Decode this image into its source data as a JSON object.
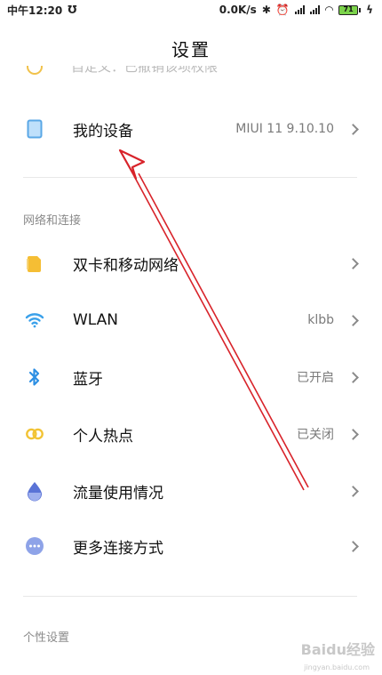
{
  "status_bar": {
    "time": "中午12:20",
    "speed": "0.0K/s",
    "battery": "71"
  },
  "header": {
    "title": "设置"
  },
  "cut_row": {
    "label": "自定义：已撤销该项权限"
  },
  "rows_top": [
    {
      "label": "我的设备",
      "value": "MIUI 11 9.10.10",
      "icon": "device-icon"
    }
  ],
  "network": {
    "title": "网络和连接",
    "items": [
      {
        "label": "双卡和移动网络",
        "value": "",
        "icon": "sim-card-icon"
      },
      {
        "label": "WLAN",
        "value": "klbb",
        "icon": "wifi-icon"
      },
      {
        "label": "蓝牙",
        "value": "已开启",
        "icon": "bluetooth-icon"
      },
      {
        "label": "个人热点",
        "value": "已关闭",
        "icon": "hotspot-icon"
      },
      {
        "label": "流量使用情况",
        "value": "",
        "icon": "data-usage-icon"
      },
      {
        "label": "更多连接方式",
        "value": "",
        "icon": "more-connections-icon"
      }
    ]
  },
  "personal": {
    "title": "个性设置"
  },
  "watermark": {
    "brand": "Baidu经验",
    "site": "jingyan.baidu.com"
  },
  "colors": {
    "device_icon": "#5aa7e6",
    "sim_icon": "#f5be34",
    "wifi_icon": "#3ba1ea",
    "bluetooth_icon": "#2d8fe3",
    "hotspot_icon": "#f2c334",
    "data_usage_icon": "#5a73d6",
    "more_icon": "#8ea3e8",
    "arrow": "#d8232a"
  }
}
